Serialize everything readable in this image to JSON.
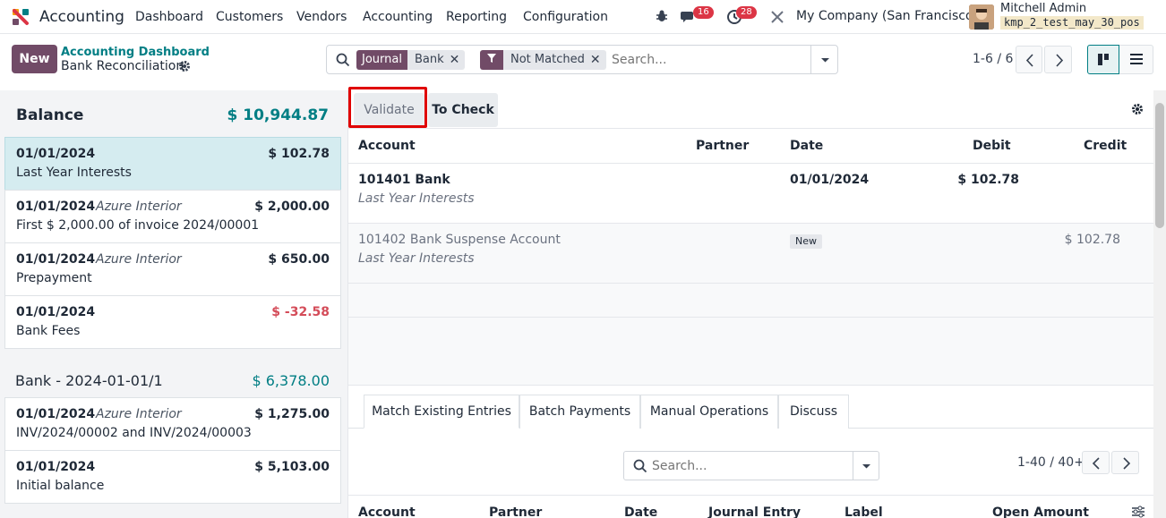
{
  "navbar": {
    "app_name": "Accounting",
    "menu": [
      "Dashboard",
      "Customers",
      "Vendors",
      "Accounting",
      "Reporting",
      "Configuration"
    ],
    "messages_count": "16",
    "activities_count": "28",
    "company": "My Company (San Francisco)",
    "user_name": "Mitchell Admin",
    "database": "kmp_2_test_may_30_pos"
  },
  "control": {
    "new_label": "New",
    "breadcrumb_parent": "Accounting Dashboard",
    "breadcrumb_current": "Bank Reconciliation",
    "search": {
      "facet1_cat": "Journal",
      "facet1_val": "Bank",
      "facet2_val": "Not Matched",
      "placeholder": "Search..."
    },
    "pager": "1-6 / 6"
  },
  "left": {
    "balance_label": "Balance",
    "balance_amount": "$ 10,944.87",
    "lines": [
      {
        "date": "01/01/2024",
        "partner": "",
        "amount": "$ 102.78",
        "label": "Last Year Interests"
      },
      {
        "date": "01/01/2024",
        "partner": "Azure Interior",
        "amount": "$ 2,000.00",
        "label": "First $ 2,000.00 of invoice 2024/00001"
      },
      {
        "date": "01/01/2024",
        "partner": "Azure Interior",
        "amount": "$ 650.00",
        "label": "Prepayment"
      },
      {
        "date": "01/01/2024",
        "partner": "",
        "amount": "$ -32.58",
        "label": "Bank Fees"
      }
    ],
    "statement_label": "Bank - 2024-01-01/1",
    "statement_amount": "$ 6,378.00",
    "statement_lines": [
      {
        "date": "01/01/2024",
        "partner": "Azure Interior",
        "amount": "$ 1,275.00",
        "label": "INV/2024/00002 and INV/2024/00003"
      },
      {
        "date": "01/01/2024",
        "partner": "",
        "amount": "$ 5,103.00",
        "label": "Initial balance"
      }
    ]
  },
  "right": {
    "validate_label": "Validate",
    "tocheck_label": "To Check",
    "headers": {
      "account": "Account",
      "partner": "Partner",
      "date": "Date",
      "debit": "Debit",
      "credit": "Credit"
    },
    "row1": {
      "account": "101401 Bank",
      "label": "Last Year Interests",
      "date": "01/01/2024",
      "debit": "$ 102.78"
    },
    "row2": {
      "account": "101402 Bank Suspense Account",
      "label": "Last Year Interests",
      "badge": "New",
      "credit": "$ 102.78"
    },
    "tabs": [
      "Match Existing Entries",
      "Batch Payments",
      "Manual Operations",
      "Discuss"
    ],
    "search_placeholder": "Search...",
    "pager": "1-40 / 40+",
    "bottom_headers": {
      "account": "Account",
      "partner": "Partner",
      "date": "Date",
      "journal_entry": "Journal Entry",
      "label": "Label",
      "open_amount": "Open Amount"
    }
  },
  "colors": {
    "brand": "#714B67",
    "teal": "#017e84",
    "negative": "#d44c59",
    "highlight": "#e00000"
  }
}
